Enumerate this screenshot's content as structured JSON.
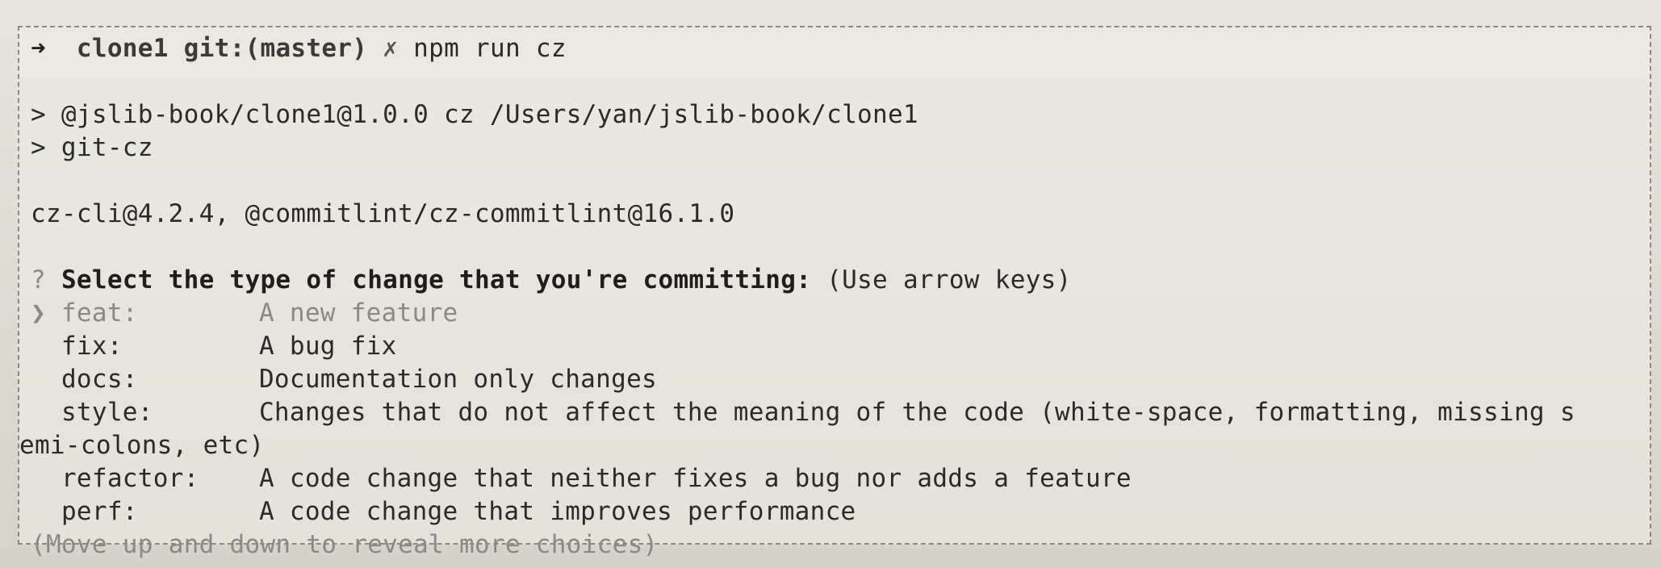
{
  "prompt": {
    "arrow": "➜",
    "directory": "clone1",
    "git": "git:(master)",
    "dirty_marker": "✗",
    "command": "npm run cz"
  },
  "npm_output": [
    "> @jslib-book/clone1@1.0.0 cz /Users/yan/jslib-book/clone1",
    "> git-cz"
  ],
  "versions": "cz-cli@4.2.4, @commitlint/cz-commitlint@16.1.0",
  "question": {
    "marker": "?",
    "text": "Select the type of change that you're committing:",
    "hint": "(Use arrow keys)"
  },
  "pointer": "❯",
  "choices": [
    {
      "name": "feat:",
      "desc": "A new feature",
      "selected": true
    },
    {
      "name": "fix:",
      "desc": "A bug fix",
      "selected": false
    },
    {
      "name": "docs:",
      "desc": "Documentation only changes",
      "selected": false
    },
    {
      "name": "style:",
      "desc": "Changes that do not affect the meaning of the code (white-space, formatting, missing s",
      "desc_wrap": "emi-colons, etc)",
      "selected": false
    },
    {
      "name": "refactor:",
      "desc": "A code change that neither fixes a bug nor adds a feature",
      "selected": false
    },
    {
      "name": "perf:",
      "desc": "A code change that improves performance",
      "selected": false
    }
  ],
  "footer_hint": "(Move up and down to reveal more choices)"
}
